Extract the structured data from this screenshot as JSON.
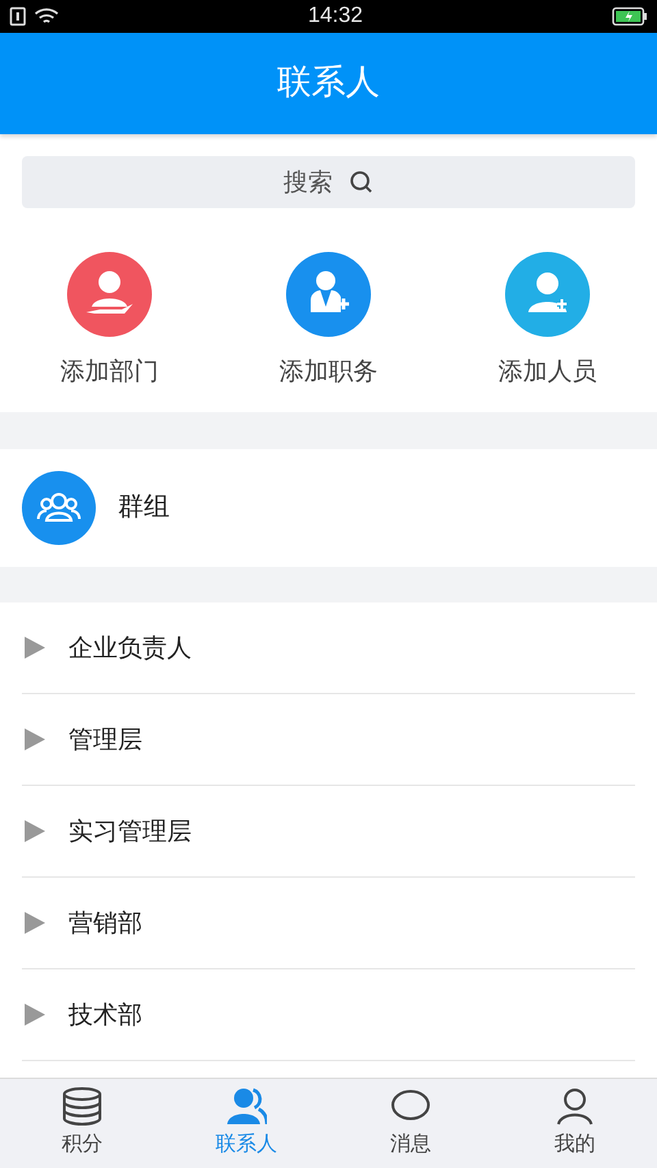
{
  "status_bar": {
    "time": "14:32"
  },
  "header": {
    "title": "联系人"
  },
  "search": {
    "placeholder": "搜索"
  },
  "actions": [
    {
      "label": "添加部门",
      "kind": "department",
      "color": "#f0555f"
    },
    {
      "label": "添加职务",
      "kind": "position",
      "color": "#1890ee"
    },
    {
      "label": "添加人员",
      "kind": "person",
      "color": "#22aee6"
    }
  ],
  "group": {
    "label": "群组"
  },
  "departments": [
    {
      "label": "企业负责人",
      "expanded": false
    },
    {
      "label": "管理层",
      "expanded": false
    },
    {
      "label": "实习管理层",
      "expanded": false
    },
    {
      "label": "营销部",
      "expanded": false
    },
    {
      "label": "技术部",
      "expanded": false
    }
  ],
  "tabs": [
    {
      "label": "积分",
      "kind": "points",
      "selected": false
    },
    {
      "label": "联系人",
      "kind": "contacts",
      "selected": true
    },
    {
      "label": "消息",
      "kind": "messages",
      "selected": false
    },
    {
      "label": "我的",
      "kind": "me",
      "selected": false
    }
  ]
}
